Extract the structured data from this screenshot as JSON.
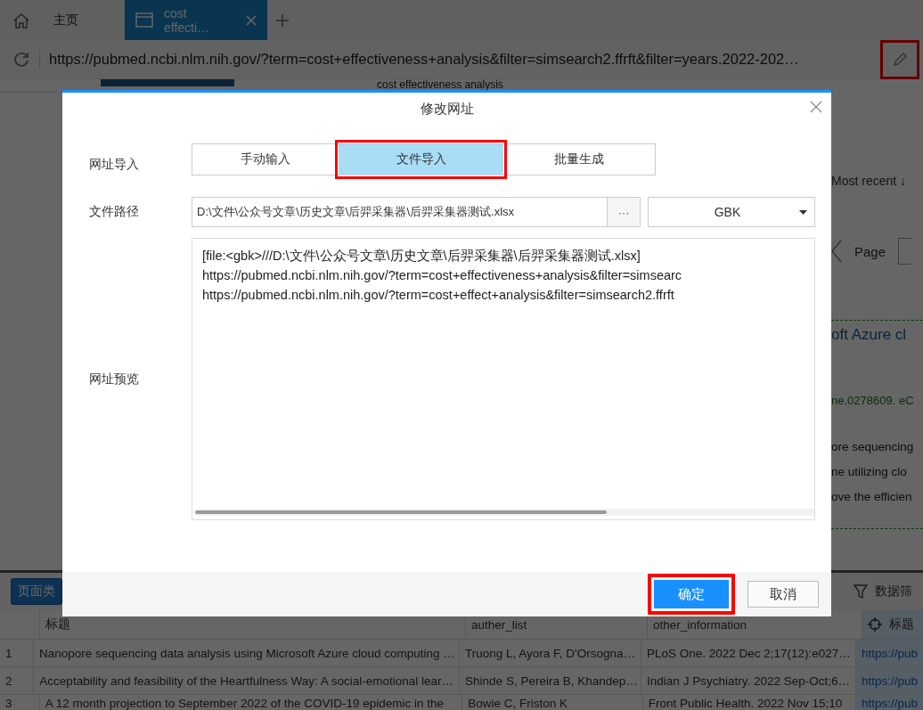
{
  "browser": {
    "tabs": [
      {
        "label": "主页",
        "kind": "home",
        "selected": false
      },
      {
        "label": "cost effecti…",
        "kind": "page",
        "selected": true
      }
    ],
    "address_bar": {
      "url": "https://pubmed.ncbi.nlm.nih.gov/?term=cost+effectiveness+analysis&filter=simsearch2.ffrft&filter=years.2022-202…",
      "edit_highlighted": true
    }
  },
  "page": {
    "heading": "cost effectiveness analysis",
    "sort": "Most recent ↓",
    "pager_label": "Page",
    "result_title": "oft Azure cl",
    "result_citation": "ne.0278609. eC",
    "snippet_lines": [
      "ore sequencing",
      "ne utilizing clo",
      "ove the efficien"
    ]
  },
  "dialog": {
    "title": "修改网址",
    "import_label": "网址导入",
    "modes": [
      {
        "label": "手动输入",
        "selected": false,
        "highlighted": false
      },
      {
        "label": "文件导入",
        "selected": true,
        "highlighted": true
      },
      {
        "label": "批量生成",
        "selected": false,
        "highlighted": false
      }
    ],
    "path_label": "文件路径",
    "path_value": "D:\\文件\\公众号文章\\历史文章\\后羿采集器\\后羿采集器测试.xlsx",
    "browse": "···",
    "encoding": "GBK",
    "preview_label": "网址预览",
    "preview_lines": [
      "[file:<gbk>///D:\\文件\\公众号文章\\历史文章\\后羿采集器\\后羿采集器测试.xlsx]",
      "https://pubmed.ncbi.nlm.nih.gov/?term=cost+effectiveness+analysis&filter=simsearc",
      "https://pubmed.ncbi.nlm.nih.gov/?term=cost+effect+analysis&filter=simsearch2.ffrft"
    ],
    "buttons": [
      {
        "label": "确定",
        "kind": "primary",
        "highlighted": true
      },
      {
        "label": "取消",
        "kind": "default",
        "highlighted": false
      }
    ]
  },
  "toolbar": {
    "page_type_button": "页面类",
    "filter_label": "数据筛"
  },
  "table": {
    "columns": [
      "标题",
      "auther_list",
      "other_information",
      "标题"
    ],
    "rows": [
      {
        "index": "1",
        "cells": [
          "Nanopore sequencing data analysis using Microsoft Azure cloud computing …",
          "Truong L, Ayora F, D'Orsogna…",
          "PLoS One. 2022 Dec 2;17(12):e027…",
          "https://pub"
        ]
      },
      {
        "index": "2",
        "cells": [
          "Acceptability and feasibility of the Heartfulness Way: A social-emotional lear…",
          "Shinde S, Pereira B, Khandep…",
          "Indian J Psychiatry. 2022 Sep-Oct;6…",
          "https://pub"
        ]
      },
      {
        "index": "3",
        "cells": [
          "A 12 month projection to September 2022 of the COVID-19 epidemic in the",
          "Bowie C, Friston K",
          "Front Public Health. 2022 Nov 15;10",
          "https://pub"
        ]
      }
    ]
  }
}
